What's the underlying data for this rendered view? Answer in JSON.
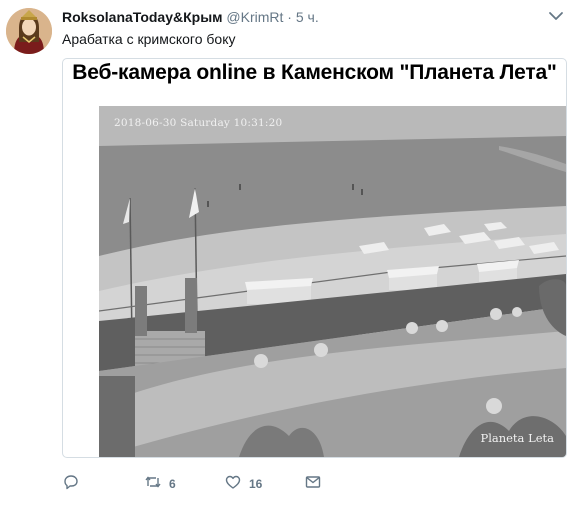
{
  "tweet": {
    "display_name": "RoksolanaToday&Крым",
    "handle": "@KrimRt",
    "separator": "·",
    "time": "5 ч.",
    "text": "Арабатка с кримского боку"
  },
  "card": {
    "headline": "Веб-камера online в Каменском \"Планета Лета\"",
    "overlay_timestamp": "2018-06-30 Saturday 10:31:20",
    "overlay_brand": "Planeta Leta"
  },
  "actions": {
    "retweet_count": "6",
    "like_count": "16"
  },
  "icons": {
    "reply": "reply-icon",
    "retweet": "retweet-icon",
    "like": "heart-icon",
    "message": "envelope-icon",
    "caret": "chevron-down-icon"
  },
  "colors": {
    "secondary_text": "#657786",
    "card_border": "#d5dde3",
    "icon": "#657786"
  }
}
